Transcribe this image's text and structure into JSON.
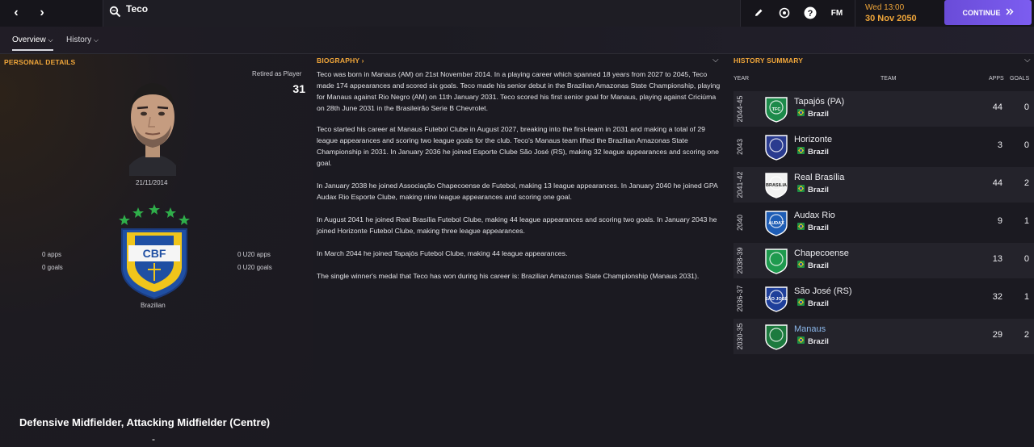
{
  "topbar": {
    "back_glyph": "‹",
    "forward_glyph": "›",
    "search_value": "Teco",
    "fm_label": "FM",
    "date_line1": "Wed 13:00",
    "date_line2": "30 Nov 2050",
    "continue_label": "CONTINUE"
  },
  "subnav": {
    "tabs": [
      {
        "label": "Overview"
      },
      {
        "label": "History"
      }
    ]
  },
  "personal": {
    "heading": "PERSONAL DETAILS",
    "retired_label": "Retired as Player",
    "retired_age": "31",
    "dob": "21/11/2014",
    "apps": "0 apps",
    "goals": "0 goals",
    "u20_apps": "0 U20 apps",
    "u20_goals": "0 U20 goals",
    "nationality": "Brazilian",
    "crest_text": "CBF",
    "position": "Defensive Midfielder, Attacking Midfielder (Centre)",
    "dash": "-"
  },
  "biography": {
    "heading": "BIOGRAPHY ›",
    "paragraphs": [
      "Teco was born in Manaus (AM) on 21st November 2014. In a playing career which spanned 18 years from 2027 to 2045, Teco made 174 appearances and scored six goals. Teco made his senior debut in the Brazilian Amazonas State Championship, playing for Manaus against Rio Negro (AM) on 11th January 2031. Teco scored his first senior goal for Manaus, playing against Criciúma on 28th June 2031 in the Brasileirão Serie B Chevrolet.",
      "Teco started his career at Manaus Futebol Clube in August 2027, breaking into the first-team in 2031 and making a total of 29 league appearances and scoring two league goals for the club. Teco's Manaus team lifted the Brazilian Amazonas State Championship in 2031. In January 2036 he joined Esporte Clube São José (RS), making 32 league appearances and scoring one goal.",
      "In January 2038 he joined Associação Chapecoense de Futebol, making 13 league appearances. In January 2040 he joined GPA Audax Rio Esporte Clube, making nine league appearances and scoring one goal.",
      "In August 2041 he joined Real Brasília Futebol Clube, making 44 league appearances and scoring two goals. In January 2043 he joined Horizonte Futebol Clube, making three league appearances.",
      "In March 2044 he joined Tapajós Futebol Clube, making 44 league appearances.",
      "The single winner's medal that Teco has won during his career is: Brazilian Amazonas State Championship (Manaus 2031)."
    ]
  },
  "history": {
    "heading": "HISTORY SUMMARY",
    "col_year": "YEAR",
    "col_team": "TEAM",
    "col_apps": "APPS",
    "col_goals": "GOALS",
    "rows": [
      {
        "year": "2044-45",
        "team": "Tapajós (PA)",
        "nation": "Brazil",
        "apps": "44",
        "goals": "0",
        "crest": "TFC",
        "crest_color": "#1c8a4a"
      },
      {
        "year": "2043",
        "team": "Horizonte",
        "nation": "Brazil",
        "apps": "3",
        "goals": "0",
        "crest": "",
        "crest_color": "#2a3b8f"
      },
      {
        "year": "2041-42",
        "team": "Real Brasília",
        "nation": "Brazil",
        "apps": "44",
        "goals": "2",
        "crest": "BRASILIA",
        "crest_color": "#f2f2f2"
      },
      {
        "year": "2040",
        "team": "Audax Rio",
        "nation": "Brazil",
        "apps": "9",
        "goals": "1",
        "crest": "AUDAX",
        "crest_color": "#1e5db5"
      },
      {
        "year": "2038-39",
        "team": "Chapecoense",
        "nation": "Brazil",
        "apps": "13",
        "goals": "0",
        "crest": "",
        "crest_color": "#1e9a4e"
      },
      {
        "year": "2036-37",
        "team": "São José (RS)",
        "nation": "Brazil",
        "apps": "32",
        "goals": "1",
        "crest": "SÃO JOSÉ",
        "crest_color": "#1f3f9a"
      },
      {
        "year": "2030-35",
        "team": "Manaus",
        "nation": "Brazil",
        "apps": "29",
        "goals": "2",
        "crest": "",
        "crest_color": "#1c7a3e"
      }
    ]
  },
  "colors": {
    "accent": "#f0a63a",
    "continue": "#7c5df0",
    "link": "#8bb7ea"
  }
}
